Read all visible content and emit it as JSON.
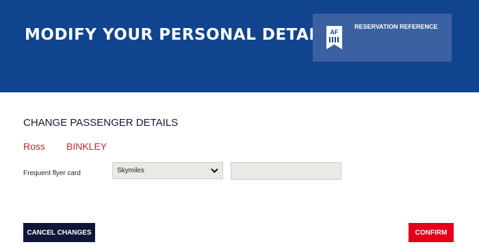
{
  "header": {
    "title": "MODIFY YOUR PERSONAL DETAILS",
    "reservation_label": "RESERVATION REFERENCE",
    "reservation_value": "",
    "badge_text": "AF"
  },
  "section": {
    "title": "CHANGE PASSENGER DETAILS"
  },
  "passenger": {
    "first_name": "Ross",
    "last_name": "BINKLEY"
  },
  "frequent_flyer": {
    "label": "Frequent flyer card",
    "program_selected": "Skymiles",
    "number_value": ""
  },
  "actions": {
    "cancel_label": "CANCEL CHANGES",
    "confirm_label": "CONFIRM"
  },
  "colors": {
    "header_bg": "#11448e",
    "panel_bg": "#3c61a2",
    "accent_red": "#e2001a",
    "name_red": "#c1272d",
    "dark_button": "#0f1638"
  }
}
